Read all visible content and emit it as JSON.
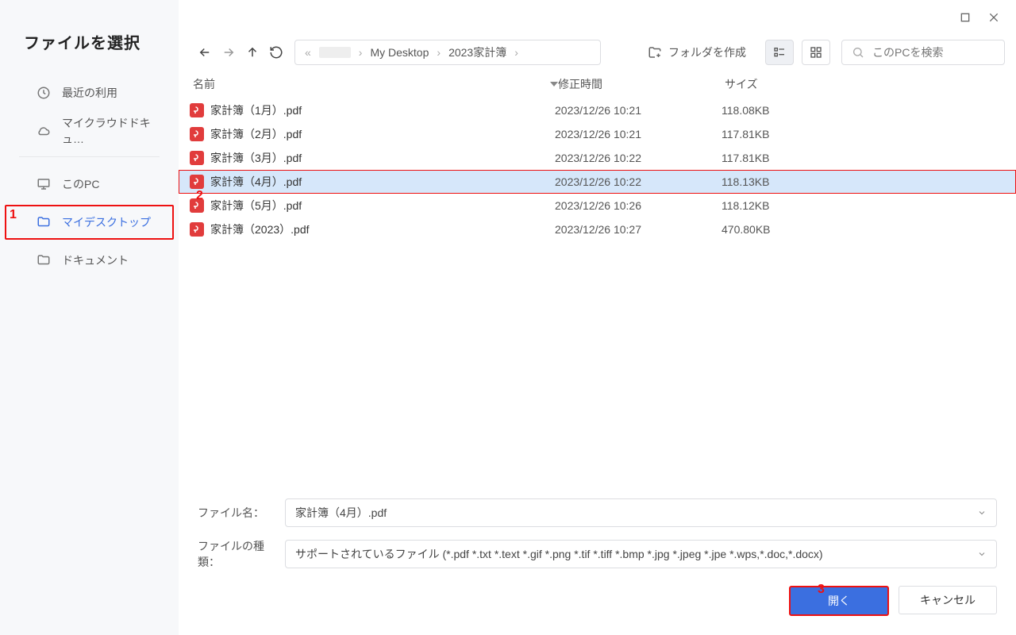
{
  "title": "ファイルを選択",
  "sidebar": {
    "recent": "最近の利用",
    "cloud": "マイクラウドドキュ…",
    "thispc": "このPC",
    "desktop": "マイデスクトップ",
    "documents": "ドキュメント"
  },
  "breadcrumb": {
    "a": "«",
    "b": "My Desktop",
    "c": "2023家計簿"
  },
  "toolbar": {
    "new_folder": "フォルダを作成",
    "search_placeholder": "このPCを検索"
  },
  "columns": {
    "name": "名前",
    "time": "修正時間",
    "size": "サイズ"
  },
  "files": [
    {
      "name": "家計簿（1月）.pdf",
      "time": "2023/12/26 10:21",
      "size": "118.08KB",
      "selected": false
    },
    {
      "name": "家計簿（2月）.pdf",
      "time": "2023/12/26 10:21",
      "size": "117.81KB",
      "selected": false
    },
    {
      "name": "家計簿（3月）.pdf",
      "time": "2023/12/26 10:22",
      "size": "117.81KB",
      "selected": false
    },
    {
      "name": "家計簿（4月）.pdf",
      "time": "2023/12/26 10:22",
      "size": "118.13KB",
      "selected": true
    },
    {
      "name": "家計簿（5月）.pdf",
      "time": "2023/12/26 10:26",
      "size": "118.12KB",
      "selected": false
    },
    {
      "name": "家計簿（2023）.pdf",
      "time": "2023/12/26 10:27",
      "size": "470.80KB",
      "selected": false
    }
  ],
  "bottom": {
    "filename_label": "ファイル名：",
    "filename_value": "家計簿（4月）.pdf",
    "filetype_label": "ファイルの種類：",
    "filetype_value": "サポートされているファイル (*.pdf *.txt *.text *.gif *.png *.tif *.tiff *.bmp *.jpg *.jpeg *.jpe *.wps,*.doc,*.docx)",
    "open": "開く",
    "cancel": "キャンセル"
  },
  "callouts": {
    "c1": "1",
    "c2": "2",
    "c3": "3"
  }
}
